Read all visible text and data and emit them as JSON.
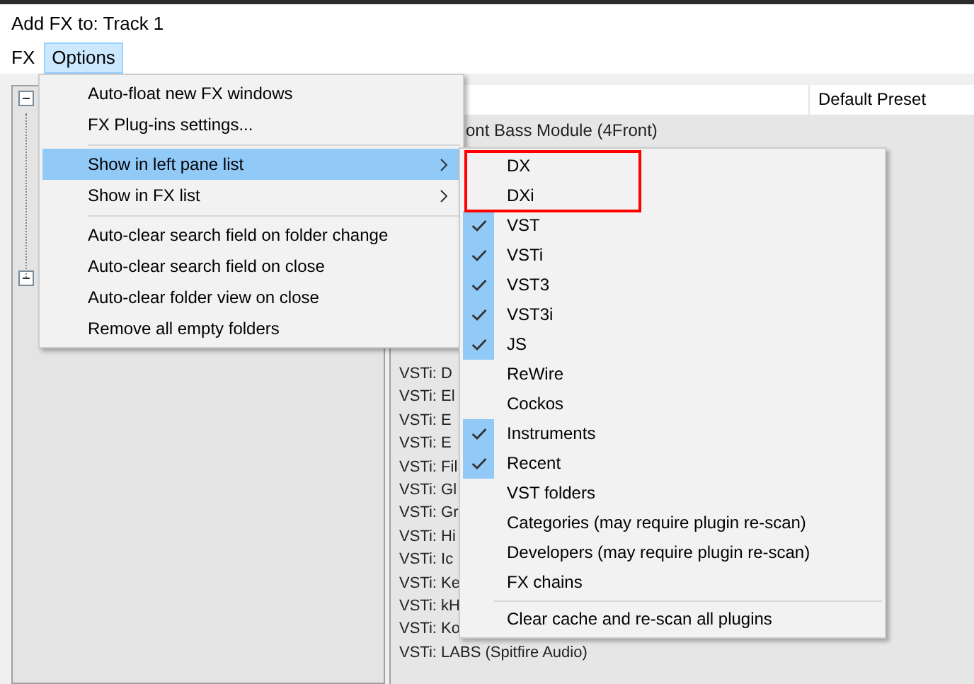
{
  "window": {
    "title": "Add FX to: Track 1"
  },
  "menubar": [
    {
      "label": "FX",
      "selected": false
    },
    {
      "label": "Options",
      "selected": true
    }
  ],
  "tree": [
    {
      "expanded": true
    },
    {
      "expanded": true
    }
  ],
  "fx_list": {
    "column_2": "Default Preset",
    "rows": [
      {
        "label": "ont Bass Module (4Front)"
      },
      {
        "label": "VSTi: D"
      },
      {
        "label": "VSTi: El"
      },
      {
        "label": "VSTi: E"
      },
      {
        "label": "VSTi: E"
      },
      {
        "label": "VSTi: Fil"
      },
      {
        "label": "VSTi: Gl"
      },
      {
        "label": "VSTi: Gr"
      },
      {
        "label": "VSTi: Hi"
      },
      {
        "label": "VSTi: Ic"
      },
      {
        "label": "VSTi: Ke"
      },
      {
        "label": "VSTi: kH"
      },
      {
        "label": "VSTi: Ko"
      },
      {
        "label": "VSTi: LABS (Spitfire Audio)"
      }
    ]
  },
  "options_menu": {
    "items": [
      {
        "kind": "item",
        "label": "Auto-float new FX windows",
        "selected": false,
        "submenu": false
      },
      {
        "kind": "item",
        "label": "FX Plug-ins settings...",
        "selected": false,
        "submenu": false
      },
      {
        "kind": "separator"
      },
      {
        "kind": "item",
        "label": "Show in left pane list",
        "selected": true,
        "submenu": true
      },
      {
        "kind": "item",
        "label": "Show in FX list",
        "selected": false,
        "submenu": true
      },
      {
        "kind": "separator"
      },
      {
        "kind": "item",
        "label": "Auto-clear search field on folder change",
        "selected": false,
        "submenu": false
      },
      {
        "kind": "item",
        "label": "Auto-clear search field on close",
        "selected": false,
        "submenu": false
      },
      {
        "kind": "item",
        "label": "Auto-clear folder view on close",
        "selected": false,
        "submenu": false
      },
      {
        "kind": "item",
        "label": "Remove all empty folders",
        "selected": false,
        "submenu": false
      }
    ]
  },
  "left_pane_submenu": {
    "items": [
      {
        "kind": "item",
        "label": "DX",
        "checked": false,
        "outlined": true
      },
      {
        "kind": "item",
        "label": "DXi",
        "checked": false,
        "outlined": true
      },
      {
        "kind": "item",
        "label": "VST",
        "checked": true,
        "outlined": false
      },
      {
        "kind": "item",
        "label": "VSTi",
        "checked": true,
        "outlined": false
      },
      {
        "kind": "item",
        "label": "VST3",
        "checked": true,
        "outlined": false
      },
      {
        "kind": "item",
        "label": "VST3i",
        "checked": true,
        "outlined": false
      },
      {
        "kind": "item",
        "label": "JS",
        "checked": true,
        "outlined": false
      },
      {
        "kind": "item",
        "label": "ReWire",
        "checked": false,
        "outlined": false
      },
      {
        "kind": "item",
        "label": "Cockos",
        "checked": false,
        "outlined": false
      },
      {
        "kind": "item",
        "label": "Instruments",
        "checked": true,
        "outlined": false
      },
      {
        "kind": "item",
        "label": "Recent",
        "checked": true,
        "outlined": false
      },
      {
        "kind": "item",
        "label": "VST folders",
        "checked": false,
        "outlined": false
      },
      {
        "kind": "item",
        "label": "Categories (may require plugin re-scan)",
        "checked": false,
        "outlined": false
      },
      {
        "kind": "item",
        "label": "Developers (may require plugin re-scan)",
        "checked": false,
        "outlined": false
      },
      {
        "kind": "item",
        "label": "FX chains",
        "checked": false,
        "outlined": false
      },
      {
        "kind": "separator"
      },
      {
        "kind": "item",
        "label": "Clear cache and re-scan all plugins",
        "checked": false,
        "outlined": false
      }
    ]
  }
}
